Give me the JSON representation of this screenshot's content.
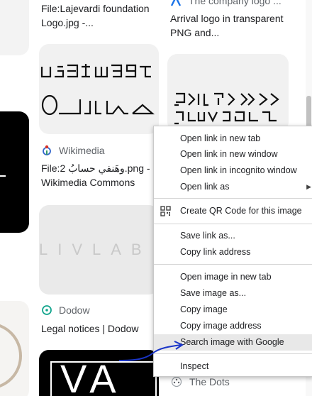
{
  "results": {
    "col1_top_title": "File:Lajevardi foundation Logo.jpg -...",
    "col2_top_source": "The company logo ...",
    "col2_top_title": "Arrival logo in transparent PNG and...",
    "tile2_glyphs_line1": "ᒍᑎᑕᓱᑭᑲ",
    "tile2_glyphs_line2": "ᐅᐧᐃᐅᐧᑲᑲ",
    "item2": {
      "source": "Wikimedia",
      "title": "File:2 وهَنفي حسابُ.png - Wikimedia Commons"
    },
    "livlab_text": "LIVLAB",
    "item3": {
      "source": "Dodow",
      "title": "Legal notices | Dodow"
    },
    "va_text": "VA",
    "item4_source": "The Dots",
    "arrival_line1": "ᗑᐸᒍᒪᐳᐸ",
    "arrival_line2": "ᒍᓗᐯᑭᒋᒪ"
  },
  "context_menu": {
    "items": [
      "Open link in new tab",
      "Open link in new window",
      "Open link in incognito window",
      "Open link as",
      "Create QR Code for this image",
      "Save link as...",
      "Copy link address",
      "Open image in new tab",
      "Save image as...",
      "Copy image",
      "Copy image address",
      "Search image with Google",
      "Inspect"
    ],
    "highlighted": "Search image with Google"
  },
  "colors": {
    "menu_highlight": "#e8e8e8",
    "annotation_arrow": "#1a35c8",
    "wikimedia_red": "#d93025",
    "dodow_teal": "#12a58d"
  }
}
